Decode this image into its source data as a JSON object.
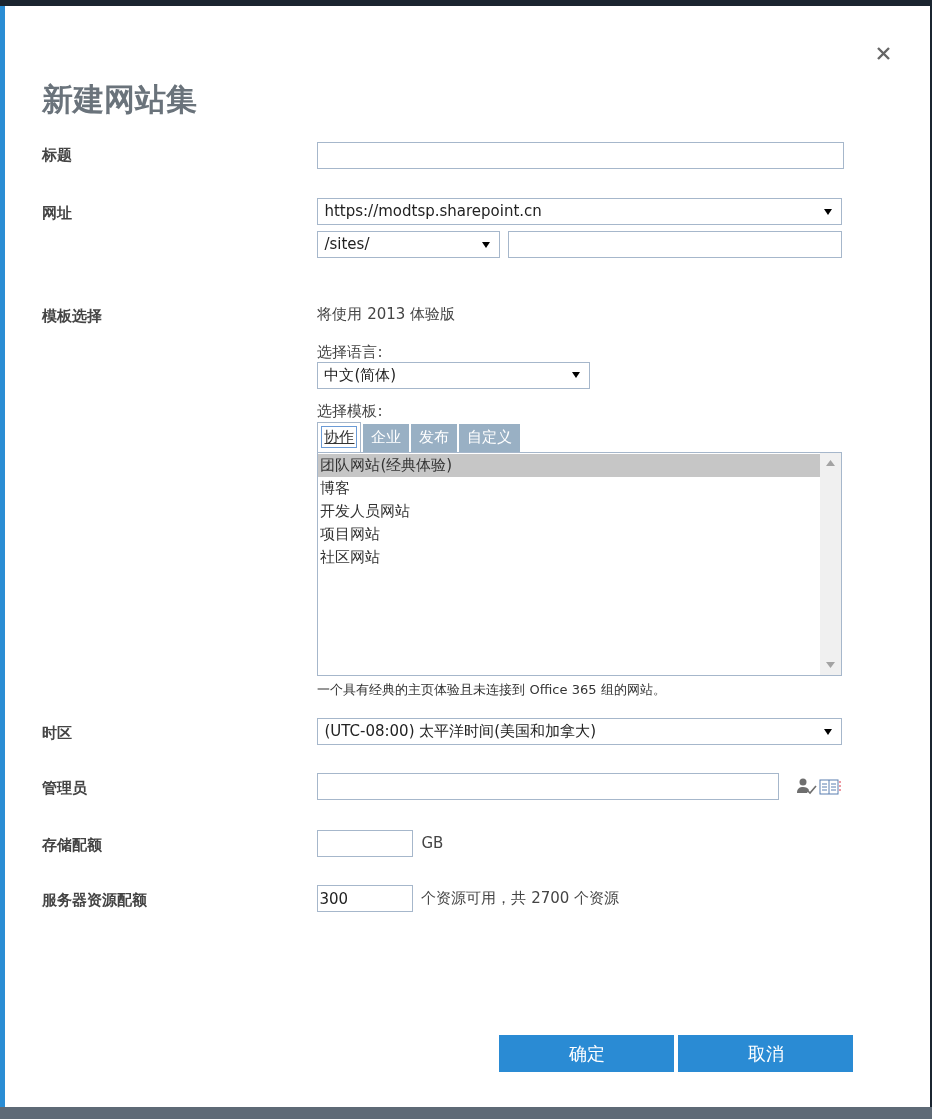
{
  "title": "新建网站集",
  "fields": [
    {
      "kind": "text",
      "label": "标题"
    },
    {
      "kind": "url",
      "label": "网址",
      "domain": "https://modtsp.sharepoint.cn",
      "path": "/sites/"
    },
    {
      "kind": "template",
      "label": "模板选择",
      "note": "将使用 2013 体验版",
      "language_label": "选择语言:",
      "language": "中文(简体)",
      "template_label": "选择模板:",
      "tabs": [
        {
          "label": "协作",
          "selected": true
        },
        {
          "label": "企业",
          "selected": false
        },
        {
          "label": "发布",
          "selected": false
        },
        {
          "label": "自定义",
          "selected": false
        }
      ],
      "items": [
        {
          "label": "团队网站(经典体验)",
          "selected": true
        },
        {
          "label": "博客",
          "selected": false
        },
        {
          "label": "开发人员网站",
          "selected": false
        },
        {
          "label": "项目网站",
          "selected": false
        },
        {
          "label": "社区网站",
          "selected": false
        }
      ],
      "description": "一个具有经典的主页体验且未连接到 Office 365 组的网站。"
    },
    {
      "kind": "select",
      "label": "时区",
      "value": "(UTC-08:00) 太平洋时间(美国和加拿大)"
    },
    {
      "kind": "people",
      "label": "管理员"
    },
    {
      "kind": "quota",
      "label": "存储配额",
      "unit": "GB"
    },
    {
      "kind": "quota",
      "label": "服务器资源配额",
      "value": "300",
      "unit": "个资源可用，共 2700 个资源"
    }
  ],
  "buttons": [
    "确定",
    "取消"
  ]
}
